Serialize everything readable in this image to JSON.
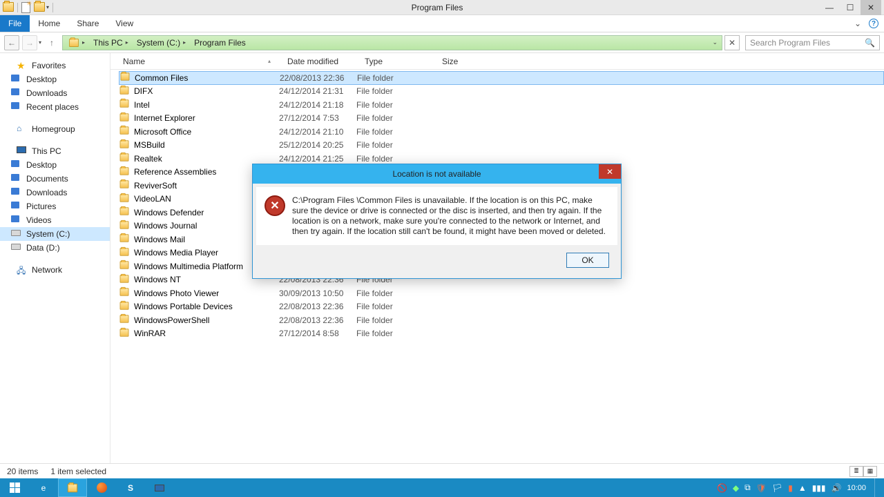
{
  "window": {
    "title": "Program Files"
  },
  "ribbon": {
    "tabs": {
      "file": "File",
      "home": "Home",
      "share": "Share",
      "view": "View"
    }
  },
  "address": {
    "segments": [
      "This PC",
      "System (C:)",
      "Program Files"
    ]
  },
  "search": {
    "placeholder": "Search Program Files"
  },
  "sidebar": {
    "favorites": {
      "label": "Favorites",
      "items": [
        "Desktop",
        "Downloads",
        "Recent places"
      ]
    },
    "homegroup": {
      "label": "Homegroup"
    },
    "thispc": {
      "label": "This PC",
      "items": [
        "Desktop",
        "Documents",
        "Downloads",
        "Pictures",
        "Videos",
        "System (C:)",
        "Data (D:)"
      ],
      "selected_index": 5
    },
    "network": {
      "label": "Network"
    }
  },
  "columns": {
    "name": "Name",
    "date": "Date modified",
    "type": "Type",
    "size": "Size"
  },
  "selected_row": 0,
  "files": [
    {
      "name": "Common Files",
      "date": "22/08/2013 22:36",
      "type": "File folder",
      "size": ""
    },
    {
      "name": "DIFX",
      "date": "24/12/2014 21:31",
      "type": "File folder",
      "size": ""
    },
    {
      "name": "Intel",
      "date": "24/12/2014 21:18",
      "type": "File folder",
      "size": ""
    },
    {
      "name": "Internet Explorer",
      "date": "27/12/2014 7:53",
      "type": "File folder",
      "size": ""
    },
    {
      "name": "Microsoft Office",
      "date": "24/12/2014 21:10",
      "type": "File folder",
      "size": ""
    },
    {
      "name": "MSBuild",
      "date": "25/12/2014 20:25",
      "type": "File folder",
      "size": ""
    },
    {
      "name": "Realtek",
      "date": "24/12/2014 21:25",
      "type": "File folder",
      "size": ""
    },
    {
      "name": "Reference Assemblies",
      "date": "",
      "type": "",
      "size": ""
    },
    {
      "name": "ReviverSoft",
      "date": "",
      "type": "",
      "size": ""
    },
    {
      "name": "VideoLAN",
      "date": "",
      "type": "",
      "size": ""
    },
    {
      "name": "Windows Defender",
      "date": "",
      "type": "",
      "size": ""
    },
    {
      "name": "Windows Journal",
      "date": "",
      "type": "",
      "size": ""
    },
    {
      "name": "Windows Mail",
      "date": "",
      "type": "",
      "size": ""
    },
    {
      "name": "Windows Media Player",
      "date": "",
      "type": "",
      "size": ""
    },
    {
      "name": "Windows Multimedia Platform",
      "date": "",
      "type": "",
      "size": ""
    },
    {
      "name": "Windows NT",
      "date": "22/08/2013 22:36",
      "type": "File folder",
      "size": ""
    },
    {
      "name": "Windows Photo Viewer",
      "date": "30/09/2013 10:50",
      "type": "File folder",
      "size": ""
    },
    {
      "name": "Windows Portable Devices",
      "date": "22/08/2013 22:36",
      "type": "File folder",
      "size": ""
    },
    {
      "name": "WindowsPowerShell",
      "date": "22/08/2013 22:36",
      "type": "File folder",
      "size": ""
    },
    {
      "name": "WinRAR",
      "date": "27/12/2014 8:58",
      "type": "File folder",
      "size": ""
    }
  ],
  "status": {
    "count": "20 items",
    "selection": "1 item selected"
  },
  "dialog": {
    "title": "Location is not available",
    "message": "C:\\Program Files \\Common Files is unavailable. If the location is on this PC, make sure the device or drive is connected or the disc is inserted, and then try again. If the location is on a network, make sure you're connected to the network or Internet, and then try again. If the location still can't be found, it might have been moved or deleted.",
    "ok": "OK"
  },
  "taskbar": {
    "clock": "10:00"
  }
}
